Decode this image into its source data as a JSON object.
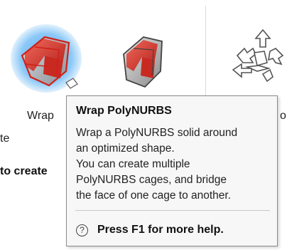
{
  "ribbon": {
    "tools": [
      {
        "name": "wrap",
        "label": "Wrap",
        "icon": "wrap-polynurbs-icon"
      },
      {
        "name": "second-tool",
        "label": "",
        "icon": "polynurbs-elbow-icon"
      },
      {
        "name": "third-tool",
        "label": "",
        "icon": "move-transform-icon"
      }
    ],
    "partial_left_1": "te",
    "partial_left_2": "to create",
    "partial_right": "o"
  },
  "tooltip": {
    "title": "Wrap PolyNURBS",
    "body_lines": [
      "Wrap a PolyNURBS solid around",
      "an optimized shape.",
      "You can create multiple",
      "PolyNURBS cages, and bridge",
      "the face of one cage to another."
    ],
    "help_icon": "question-circle-icon",
    "help_text": "Press F1 for more help."
  },
  "colors": {
    "accent_red": "#d83a32",
    "highlight_blue": "#35a9ff",
    "gray_solid": "#9a9a9a"
  }
}
